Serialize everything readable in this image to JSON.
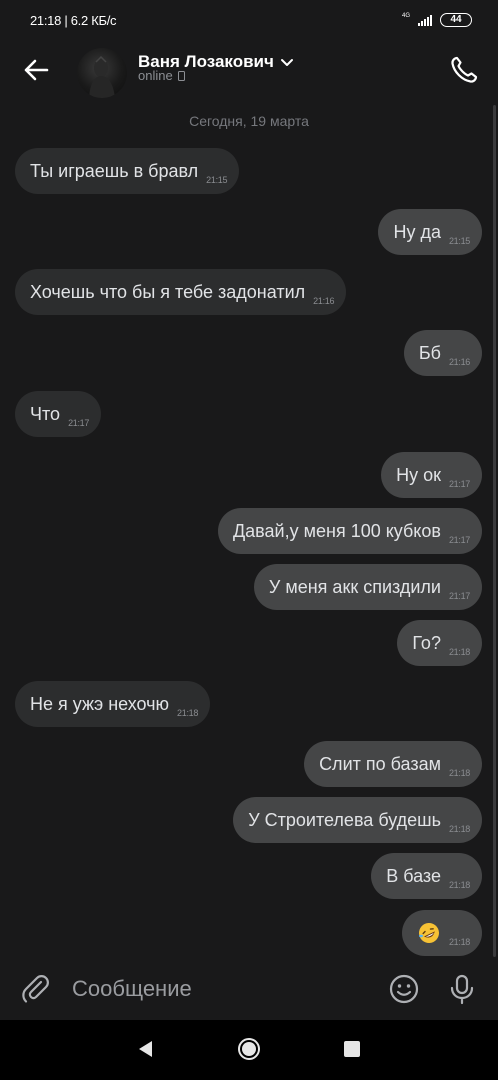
{
  "status_bar": {
    "left_text": "21:18 | 6.2 КБ/с",
    "network": "4G",
    "battery": "44"
  },
  "header": {
    "contact_name": "Ваня Лозакович",
    "status": "online",
    "icons": [
      "back-arrow-icon",
      "chevron-down-icon",
      "phone-device-icon",
      "phone-call-icon"
    ]
  },
  "chat": {
    "date_separator": "Сегодня, 19 марта",
    "messages": [
      {
        "dir": "in",
        "text": "Ты играешь в бравл",
        "time": "21:15"
      },
      {
        "dir": "out",
        "text": "Ну да",
        "time": "21:15"
      },
      {
        "dir": "in",
        "text": "Хочешь что бы я тебе задонатил",
        "time": "21:16"
      },
      {
        "dir": "out",
        "text": "Бб",
        "time": "21:16"
      },
      {
        "dir": "in",
        "text": "Что",
        "time": "21:17"
      },
      {
        "dir": "out",
        "text": "Ну ок",
        "time": "21:17"
      },
      {
        "dir": "out",
        "text": "Давай,у меня 100 кубков",
        "time": "21:17"
      },
      {
        "dir": "out",
        "text": "У меня акк спиздили",
        "time": "21:17"
      },
      {
        "dir": "out",
        "text": "Го?",
        "time": "21:18"
      },
      {
        "dir": "in",
        "text": "Не я ужэ нехочю",
        "time": "21:18"
      },
      {
        "dir": "out",
        "text": "Слит по базам",
        "time": "21:18"
      },
      {
        "dir": "out",
        "text": "У Строителева будешь",
        "time": "21:18"
      },
      {
        "dir": "out",
        "text": "В базе",
        "time": "21:18"
      },
      {
        "dir": "out",
        "text": "",
        "emoji": "rolling-on-floor-laughing-emoji",
        "time": "21:18"
      }
    ]
  },
  "composer": {
    "placeholder": "Сообщение",
    "icons": [
      "paperclip-icon",
      "smiley-icon",
      "microphone-icon"
    ]
  },
  "nav_bar": {
    "icons": [
      "nav-back-icon",
      "nav-home-icon",
      "nav-recents-icon"
    ]
  },
  "colors": {
    "background": "#19191a",
    "incoming_bubble": "#2c2d2e",
    "outgoing_bubble": "#454647",
    "text": "#e1e3e6",
    "secondary_text": "#8a8c90"
  }
}
